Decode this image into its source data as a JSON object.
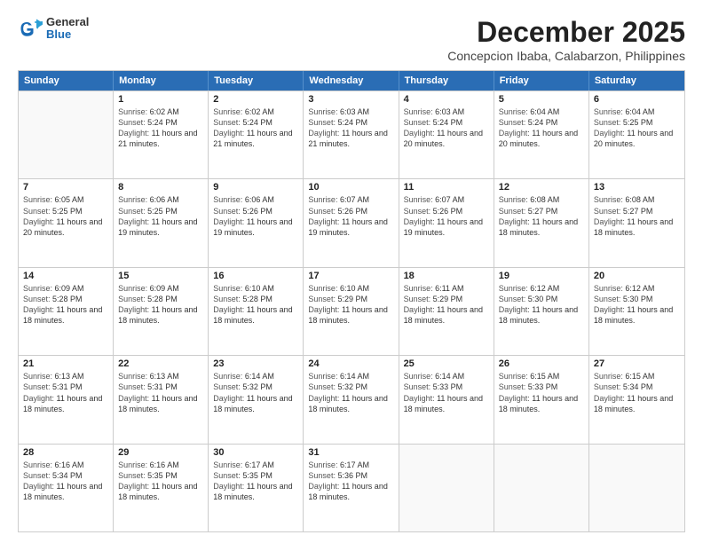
{
  "header": {
    "logo_general": "General",
    "logo_blue": "Blue",
    "title": "December 2025",
    "subtitle": "Concepcion Ibaba, Calabarzon, Philippines"
  },
  "calendar": {
    "days_of_week": [
      "Sunday",
      "Monday",
      "Tuesday",
      "Wednesday",
      "Thursday",
      "Friday",
      "Saturday"
    ],
    "weeks": [
      [
        {
          "day": "",
          "sunrise": "",
          "sunset": "",
          "daylight": ""
        },
        {
          "day": "1",
          "sunrise": "6:02 AM",
          "sunset": "5:24 PM",
          "daylight": "11 hours and 21 minutes."
        },
        {
          "day": "2",
          "sunrise": "6:02 AM",
          "sunset": "5:24 PM",
          "daylight": "11 hours and 21 minutes."
        },
        {
          "day": "3",
          "sunrise": "6:03 AM",
          "sunset": "5:24 PM",
          "daylight": "11 hours and 21 minutes."
        },
        {
          "day": "4",
          "sunrise": "6:03 AM",
          "sunset": "5:24 PM",
          "daylight": "11 hours and 20 minutes."
        },
        {
          "day": "5",
          "sunrise": "6:04 AM",
          "sunset": "5:24 PM",
          "daylight": "11 hours and 20 minutes."
        },
        {
          "day": "6",
          "sunrise": "6:04 AM",
          "sunset": "5:25 PM",
          "daylight": "11 hours and 20 minutes."
        }
      ],
      [
        {
          "day": "7",
          "sunrise": "6:05 AM",
          "sunset": "5:25 PM",
          "daylight": "11 hours and 20 minutes."
        },
        {
          "day": "8",
          "sunrise": "6:06 AM",
          "sunset": "5:25 PM",
          "daylight": "11 hours and 19 minutes."
        },
        {
          "day": "9",
          "sunrise": "6:06 AM",
          "sunset": "5:26 PM",
          "daylight": "11 hours and 19 minutes."
        },
        {
          "day": "10",
          "sunrise": "6:07 AM",
          "sunset": "5:26 PM",
          "daylight": "11 hours and 19 minutes."
        },
        {
          "day": "11",
          "sunrise": "6:07 AM",
          "sunset": "5:26 PM",
          "daylight": "11 hours and 19 minutes."
        },
        {
          "day": "12",
          "sunrise": "6:08 AM",
          "sunset": "5:27 PM",
          "daylight": "11 hours and 18 minutes."
        },
        {
          "day": "13",
          "sunrise": "6:08 AM",
          "sunset": "5:27 PM",
          "daylight": "11 hours and 18 minutes."
        }
      ],
      [
        {
          "day": "14",
          "sunrise": "6:09 AM",
          "sunset": "5:28 PM",
          "daylight": "11 hours and 18 minutes."
        },
        {
          "day": "15",
          "sunrise": "6:09 AM",
          "sunset": "5:28 PM",
          "daylight": "11 hours and 18 minutes."
        },
        {
          "day": "16",
          "sunrise": "6:10 AM",
          "sunset": "5:28 PM",
          "daylight": "11 hours and 18 minutes."
        },
        {
          "day": "17",
          "sunrise": "6:10 AM",
          "sunset": "5:29 PM",
          "daylight": "11 hours and 18 minutes."
        },
        {
          "day": "18",
          "sunrise": "6:11 AM",
          "sunset": "5:29 PM",
          "daylight": "11 hours and 18 minutes."
        },
        {
          "day": "19",
          "sunrise": "6:12 AM",
          "sunset": "5:30 PM",
          "daylight": "11 hours and 18 minutes."
        },
        {
          "day": "20",
          "sunrise": "6:12 AM",
          "sunset": "5:30 PM",
          "daylight": "11 hours and 18 minutes."
        }
      ],
      [
        {
          "day": "21",
          "sunrise": "6:13 AM",
          "sunset": "5:31 PM",
          "daylight": "11 hours and 18 minutes."
        },
        {
          "day": "22",
          "sunrise": "6:13 AM",
          "sunset": "5:31 PM",
          "daylight": "11 hours and 18 minutes."
        },
        {
          "day": "23",
          "sunrise": "6:14 AM",
          "sunset": "5:32 PM",
          "daylight": "11 hours and 18 minutes."
        },
        {
          "day": "24",
          "sunrise": "6:14 AM",
          "sunset": "5:32 PM",
          "daylight": "11 hours and 18 minutes."
        },
        {
          "day": "25",
          "sunrise": "6:14 AM",
          "sunset": "5:33 PM",
          "daylight": "11 hours and 18 minutes."
        },
        {
          "day": "26",
          "sunrise": "6:15 AM",
          "sunset": "5:33 PM",
          "daylight": "11 hours and 18 minutes."
        },
        {
          "day": "27",
          "sunrise": "6:15 AM",
          "sunset": "5:34 PM",
          "daylight": "11 hours and 18 minutes."
        }
      ],
      [
        {
          "day": "28",
          "sunrise": "6:16 AM",
          "sunset": "5:34 PM",
          "daylight": "11 hours and 18 minutes."
        },
        {
          "day": "29",
          "sunrise": "6:16 AM",
          "sunset": "5:35 PM",
          "daylight": "11 hours and 18 minutes."
        },
        {
          "day": "30",
          "sunrise": "6:17 AM",
          "sunset": "5:35 PM",
          "daylight": "11 hours and 18 minutes."
        },
        {
          "day": "31",
          "sunrise": "6:17 AM",
          "sunset": "5:36 PM",
          "daylight": "11 hours and 18 minutes."
        },
        {
          "day": "",
          "sunrise": "",
          "sunset": "",
          "daylight": ""
        },
        {
          "day": "",
          "sunrise": "",
          "sunset": "",
          "daylight": ""
        },
        {
          "day": "",
          "sunrise": "",
          "sunset": "",
          "daylight": ""
        }
      ]
    ],
    "labels": {
      "sunrise": "Sunrise:",
      "sunset": "Sunset:",
      "daylight": "Daylight:"
    }
  }
}
